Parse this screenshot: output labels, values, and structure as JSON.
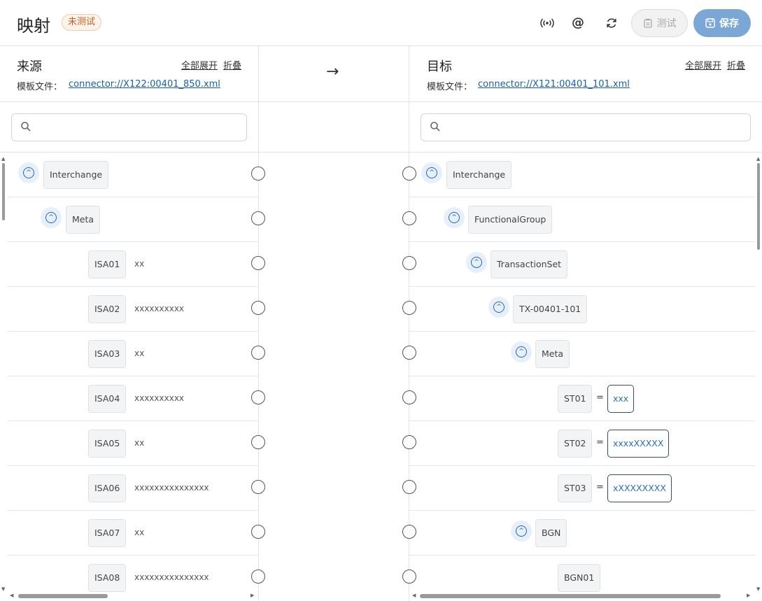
{
  "header": {
    "title": "映射",
    "status_badge": "未测试",
    "icons": [
      "broadcast-icon",
      "at-icon",
      "refresh-icon"
    ],
    "test_label": "测试",
    "save_label": "保存"
  },
  "source": {
    "title": "来源",
    "expand_all": "全部展开",
    "collapse": "折叠",
    "file_label": "模板文件：",
    "file_link": "connector://X122:00401_850.xml",
    "search_placeholder": "",
    "rows": [
      {
        "label": "Interchange",
        "value": ""
      },
      {
        "label": "Meta",
        "value": ""
      },
      {
        "label": "ISA01",
        "value": "xx"
      },
      {
        "label": "ISA02",
        "value": "xxxxxxxxxx"
      },
      {
        "label": "ISA03",
        "value": "xx"
      },
      {
        "label": "ISA04",
        "value": "xxxxxxxxxx"
      },
      {
        "label": "ISA05",
        "value": "xx"
      },
      {
        "label": "ISA06",
        "value": "xxxxxxxxxxxxxxx"
      },
      {
        "label": "ISA07",
        "value": "xx"
      },
      {
        "label": "ISA08",
        "value": "xxxxxxxxxxxxxxx"
      }
    ]
  },
  "mapping_arrow": "→",
  "target": {
    "title": "目标",
    "expand_all": "全部展开",
    "collapse": "折叠",
    "file_label": "模板文件：",
    "file_link": "connector://X121:00401_101.xml",
    "search_placeholder": "",
    "rows": [
      {
        "label": "Interchange",
        "value": ""
      },
      {
        "label": "FunctionalGroup",
        "value": ""
      },
      {
        "label": "TransactionSet",
        "value": ""
      },
      {
        "label": "TX-00401-101",
        "value": ""
      },
      {
        "label": "Meta",
        "value": ""
      },
      {
        "label": "ST01",
        "eq": "=",
        "value": "xxx"
      },
      {
        "label": "ST02",
        "eq": "=",
        "value": "xxxxXXXXX"
      },
      {
        "label": "ST03",
        "eq": "=",
        "value": "xXXXXXXXX"
      },
      {
        "label": "BGN",
        "value": ""
      },
      {
        "label": "BGN01",
        "value": ""
      }
    ]
  },
  "colors": {
    "accent": "#7aa7d6",
    "link": "#1a5fa8",
    "badge_text": "#c0602a",
    "toggle_bg": "#e6f0fb"
  }
}
